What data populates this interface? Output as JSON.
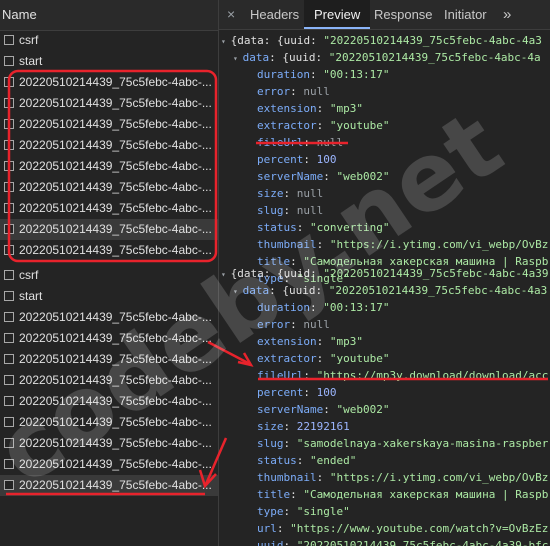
{
  "left_panel": {
    "header": "Name",
    "requests": [
      "csrf",
      "start",
      "20220510214439_75c5febc-4abc-...",
      "20220510214439_75c5febc-4abc-...",
      "20220510214439_75c5febc-4abc-...",
      "20220510214439_75c5febc-4abc-...",
      "20220510214439_75c5febc-4abc-...",
      "20220510214439_75c5febc-4abc-...",
      "20220510214439_75c5febc-4abc-...",
      "20220510214439_75c5febc-4abc-...",
      "20220510214439_75c5febc-4abc-...",
      "csrf",
      "start",
      "20220510214439_75c5febc-4abc-...",
      "20220510214439_75c5febc-4abc-...",
      "20220510214439_75c5febc-4abc-...",
      "20220510214439_75c5febc-4abc-...",
      "20220510214439_75c5febc-4abc-...",
      "20220510214439_75c5febc-4abc-...",
      "20220510214439_75c5febc-4abc-...",
      "20220510214439_75c5febc-4abc-...",
      "20220510214439_75c5febc-4abc-..."
    ]
  },
  "tabs": {
    "close": "×",
    "headers": "Headers",
    "preview": "Preview",
    "response": "Response",
    "initiator": "Initiator",
    "more": "»"
  },
  "preview1": {
    "l0_pre": "{data: {uuid: ",
    "l0_val": "\"20220510214439_75c5febc-4abc-4a3",
    "l1_key": "data",
    "l1_pre": ": {uuid: ",
    "l1_val": "\"20220510214439_75c5febc-4abc-4a",
    "duration_key": "duration",
    "duration": "\"00:13:17\"",
    "error_key": "error",
    "error": "null",
    "extension_key": "extension",
    "extension": "\"mp3\"",
    "extractor_key": "extractor",
    "extractor": "\"youtube\"",
    "fileurl_key": "fileUrl",
    "fileurl": "null",
    "percent_key": "percent",
    "percent": "100",
    "servername_key": "serverName",
    "servername": "\"web002\"",
    "size_key": "size",
    "size": "null",
    "slug_key": "slug",
    "slug": "null",
    "status_key": "status",
    "status": "\"converting\"",
    "thumbnail_key": "thumbnail",
    "thumbnail": "\"https://i.ytimg.com/vi_webp/OvBz",
    "title_key": "title",
    "title": "\"Самодельная хакерская машина | Raspb",
    "type_key": "type",
    "type": "\"single\""
  },
  "preview2": {
    "l0_pre": "{data: {uuid: ",
    "l0_val": "\"20220510214439_75c5febc-4abc-4a39",
    "l1_key": "data",
    "l1_pre": ": {uuid: ",
    "l1_val": "\"20220510214439_75c5febc-4abc-4a3",
    "duration_key": "duration",
    "duration": "\"00:13:17\"",
    "error_key": "error",
    "error": "null",
    "extension_key": "extension",
    "extension": "\"mp3\"",
    "extractor_key": "extractor",
    "extractor": "\"youtube\"",
    "fileurl_key": "fileUrl",
    "fileurl": "\"https://mp3y.download/download/acc",
    "percent_key": "percent",
    "percent": "100",
    "servername_key": "serverName",
    "servername": "\"web002\"",
    "size_key": "size",
    "size": "22192161",
    "slug_key": "slug",
    "slug": "\"samodelnaya-xakerskaya-masina-raspber",
    "status_key": "status",
    "status": "\"ended\"",
    "thumbnail_key": "thumbnail",
    "thumbnail": "\"https://i.ytimg.com/vi_webp/OvBz",
    "title_key": "title",
    "title": "\"Самодельная хакерская машина | Raspb",
    "type_key": "type",
    "type": "\"single\"",
    "url_key": "url",
    "url": "\"https://www.youtube.com/watch?v=OvBzEz",
    "uuid_key": "uuid",
    "uuid": "\"20220510214439_75c5febc-4abc-4a39-bfc"
  },
  "watermark": "codeby.net",
  "colors": {
    "background": "#242424",
    "annotation_red": "#e8232c",
    "key_blue": "#7cacf8",
    "string_green": "#ace9a4",
    "tab_active_underline": "#8ab4f8"
  }
}
